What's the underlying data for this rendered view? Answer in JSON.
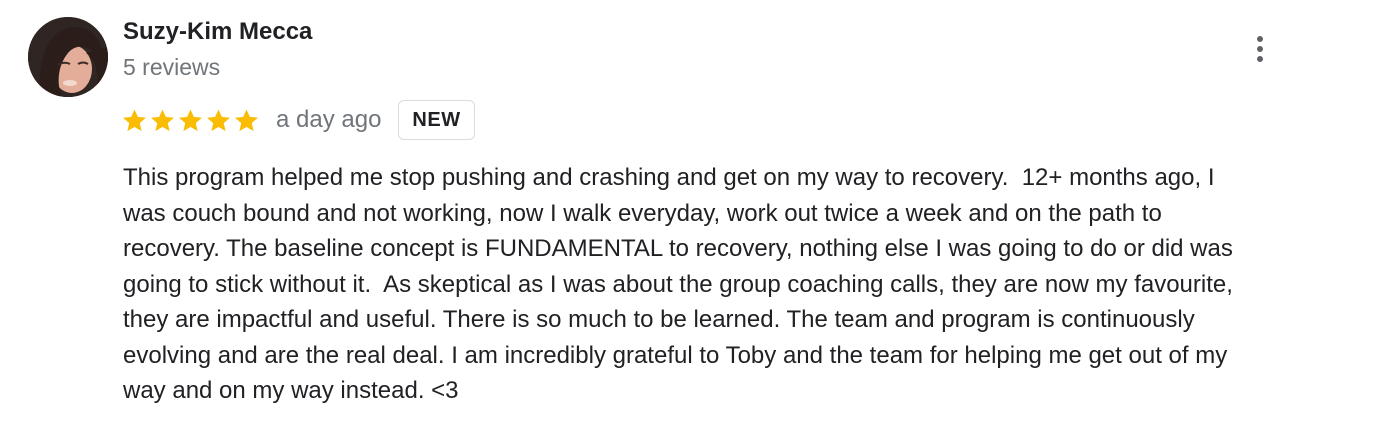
{
  "review": {
    "author": {
      "name": "Suzy-Kim Mecca",
      "review_count": "5 reviews",
      "avatar": "user-profile-photo"
    },
    "rating": {
      "stars": 5,
      "max_stars": 5,
      "color": "#fbbc04"
    },
    "date": "a day ago",
    "badge": "NEW",
    "more_icon": "more-vert-icon",
    "text_lines": [
      "This program helped me stop pushing and crashing and get on my way to recovery.  12+ months ago, I",
      "was couch bound and not working, now I walk everyday, work out twice a week and on the path to",
      "recovery. The baseline concept is FUNDAMENTAL to recovery, nothing else I was going to do or did was",
      "going to stick without it.  As skeptical as I was about the group coaching calls, they are now my favourite,",
      "they are impactful and useful. There is so much to be learned. The team and program is continuously",
      "evolving and are the real deal. I am incredibly grateful to Toby and the team for helping me get out of my",
      "way and on my way instead. <3"
    ]
  }
}
